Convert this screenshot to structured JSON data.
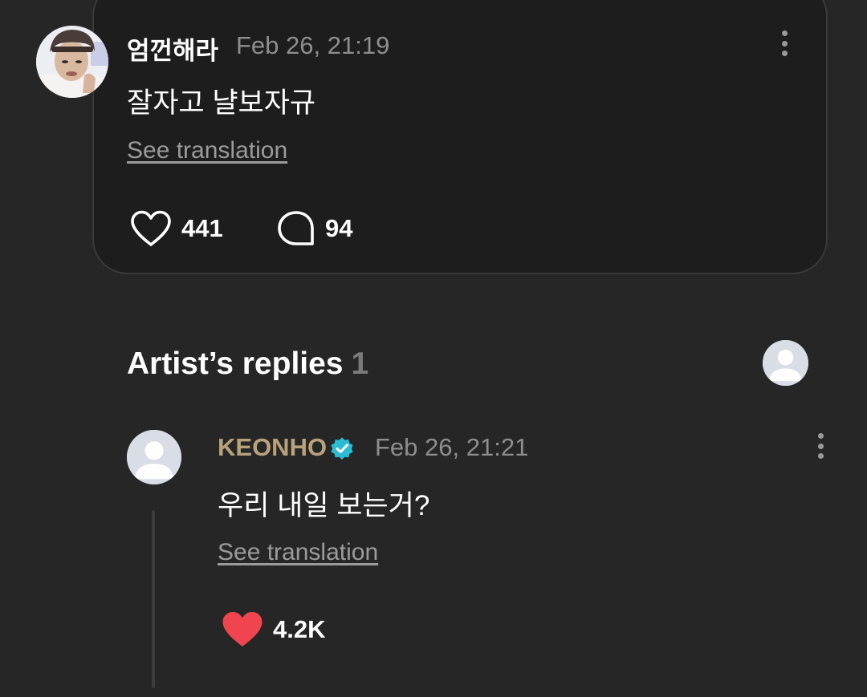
{
  "post": {
    "author": "엄껀해라",
    "timestamp": "Feb 26, 21:19",
    "text": "잘자고 냘보자규",
    "see_translation": "See translation",
    "likes": "441",
    "comments": "94"
  },
  "artist_replies": {
    "heading": "Artist’s replies",
    "count": "1"
  },
  "reply": {
    "author": "KEONHO",
    "timestamp": "Feb 26, 21:21",
    "text": "우리 내일 보는거?",
    "see_translation": "See translation",
    "likes": "4.2K"
  },
  "colors": {
    "background": "#262626",
    "card": "#1d1d1d",
    "artist_name": "#b8a27c",
    "verified_badge": "#2bbcd4",
    "liked_heart": "#f0454f",
    "muted_text": "#8e8e8e"
  },
  "icons": {
    "like": "heart-outline-icon",
    "comment": "speech-bubble-icon",
    "more": "vertical-dots-icon",
    "verified": "verified-check-icon",
    "liked": "heart-filled-icon"
  }
}
